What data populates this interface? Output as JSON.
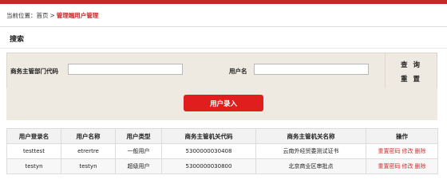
{
  "breadcrumb": {
    "prefix": "当前位置：",
    "home": "首页",
    "separator": ">",
    "current": "管理端用户管理"
  },
  "search": {
    "title": "搜索",
    "dept_code_label": "商务主管部门代码",
    "dept_code_value": "",
    "username_label": "用户名",
    "username_value": "",
    "query_button": "查 询",
    "reset_button": "重 置"
  },
  "actions": {
    "add_user_button": "用户录入"
  },
  "table": {
    "headers": [
      "用户登录名",
      "用户名称",
      "用户类型",
      "商务主管机关代码",
      "商务主管机关名称",
      "操作"
    ],
    "rows": [
      {
        "login": "testtest",
        "name": "etrertre",
        "type": "一般用户",
        "org_code": "5300000030408",
        "org_name": "云南外经贸委测试证书"
      },
      {
        "login": "testyn",
        "name": "testyn",
        "type": "超级用户",
        "org_code": "5300000030800",
        "org_name": "北京商业区审批点"
      }
    ],
    "ops": {
      "reset_password": "重置密码",
      "edit": "修改",
      "delete": "删除"
    }
  },
  "colors": {
    "brand_red": "#e01e1e",
    "filter_bg": "#efeae1",
    "link_red": "#d32f2f"
  }
}
